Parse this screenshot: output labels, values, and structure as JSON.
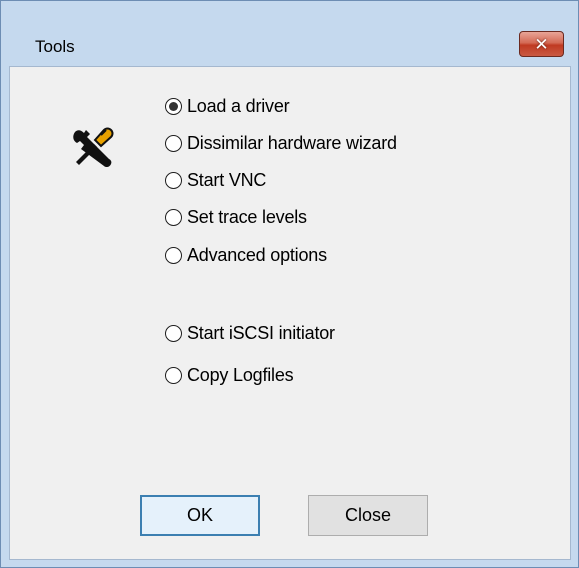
{
  "window": {
    "title": "Tools",
    "close_symbol": "✕"
  },
  "icon": "tools-screwdriver-wrench-icon",
  "options": [
    {
      "label": "Load a driver",
      "selected": true
    },
    {
      "label": "Dissimilar hardware wizard",
      "selected": false
    },
    {
      "label": "Start VNC",
      "selected": false
    },
    {
      "label": "Set trace levels",
      "selected": false
    },
    {
      "label": "Advanced options",
      "selected": false
    },
    {
      "label": "Start iSCSI initiator",
      "selected": false
    },
    {
      "label": "Copy Logfiles",
      "selected": false
    }
  ],
  "buttons": {
    "ok": "OK",
    "close": "Close"
  },
  "colors": {
    "frame": "#c5d9ee",
    "client": "#f0f0f0",
    "close_button": "#c03a22",
    "default_button_border": "#3c7fb1"
  }
}
